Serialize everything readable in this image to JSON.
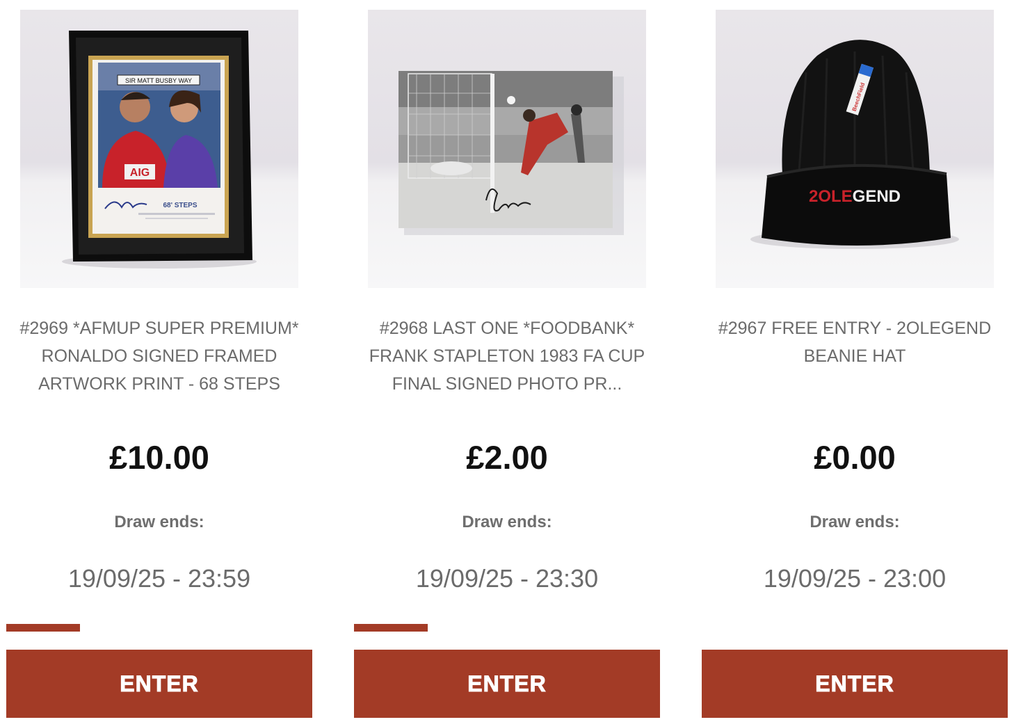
{
  "draw_label": "Draw ends:",
  "colors": {
    "accent": "#a33b26",
    "price": "#111111",
    "text_muted": "#6b6b6b"
  },
  "competitions": [
    {
      "title_lines": [
        "#2969 *AFMUP SUPER PREMIUM*",
        "RONALDO SIGNED FRAMED",
        "ARTWORK PRINT - 68 STEPS"
      ],
      "price": "£10.00",
      "draw_ends": "19/09/25 - 23:59",
      "progress_fraction": 0.24,
      "button_label": "ENTER",
      "image": {
        "description": "framed signed artwork print",
        "street_sign": "SIR MATT BUSBY WAY",
        "shirt_sponsor": "AIG",
        "caption": "68' STEPS"
      }
    },
    {
      "title_lines": [
        "#2968 LAST ONE *FOODBANK*",
        "FRANK STAPLETON 1983 FA CUP",
        "FINAL SIGNED PHOTO PR..."
      ],
      "price": "£2.00",
      "draw_ends": "19/09/25 - 23:30",
      "progress_fraction": 0.24,
      "button_label": "ENTER",
      "image": {
        "description": "signed black and white football photo"
      }
    },
    {
      "title_lines": [
        "#2967 FREE ENTRY - 2OLEGEND",
        "BEANIE HAT"
      ],
      "price": "£0.00",
      "draw_ends": "19/09/25 - 23:00",
      "progress_fraction": 0,
      "button_label": "ENTER",
      "image": {
        "description": "black beanie hat",
        "logo_red": "2OLE",
        "logo_white": "GEND",
        "tag": "BeechField"
      }
    }
  ]
}
